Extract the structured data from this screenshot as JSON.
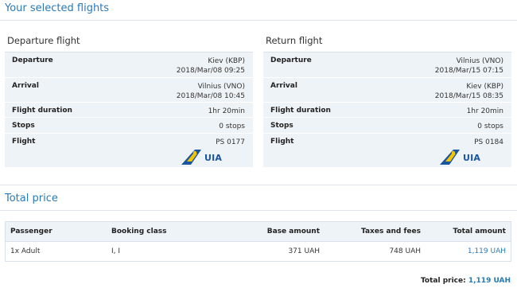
{
  "selected_flights": {
    "title": "Your selected flights",
    "departure": {
      "title": "Departure flight",
      "departure_label": "Departure",
      "departure_airport": "Kiev (KBP)",
      "departure_time": "2018/Mar/08 09:25",
      "arrival_label": "Arrival",
      "arrival_airport": "Vilnius (VNO)",
      "arrival_time": "2018/Mar/08 10:45",
      "duration_label": "Flight duration",
      "duration": "1hr 20min",
      "stops_label": "Stops",
      "stops": "0 stops",
      "flight_label": "Flight",
      "flight_number": "PS 0177",
      "airline_logo_text": "UIA"
    },
    "return": {
      "title": "Return flight",
      "departure_label": "Departure",
      "departure_airport": "Vilnius (VNO)",
      "departure_time": "2018/Mar/15 07:15",
      "arrival_label": "Arrival",
      "arrival_airport": "Kiev (KBP)",
      "arrival_time": "2018/Mar/15 08:35",
      "duration_label": "Flight duration",
      "duration": "1hr 20min",
      "stops_label": "Stops",
      "stops": "0 stops",
      "flight_label": "Flight",
      "flight_number": "PS 0184",
      "airline_logo_text": "UIA"
    }
  },
  "total_price": {
    "title": "Total price",
    "columns": {
      "passenger": "Passenger",
      "booking_class": "Booking class",
      "base_amount": "Base amount",
      "taxes": "Taxes and fees",
      "total": "Total amount"
    },
    "rows": [
      {
        "passenger": "1x Adult",
        "booking_class": "I, I",
        "base_amount": "371 UAH",
        "taxes": "748 UAH",
        "total": "1,119 UAH"
      }
    ],
    "summary_label": "Total price:",
    "summary_amount": "1,119 UAH"
  },
  "colors": {
    "accent": "#2a7ab6",
    "panel": "#eef3f7",
    "logo_blue": "#1a56a0",
    "logo_yellow": "#f5c400"
  },
  "icons": {
    "airline_logo": "uia-tail-logo"
  }
}
